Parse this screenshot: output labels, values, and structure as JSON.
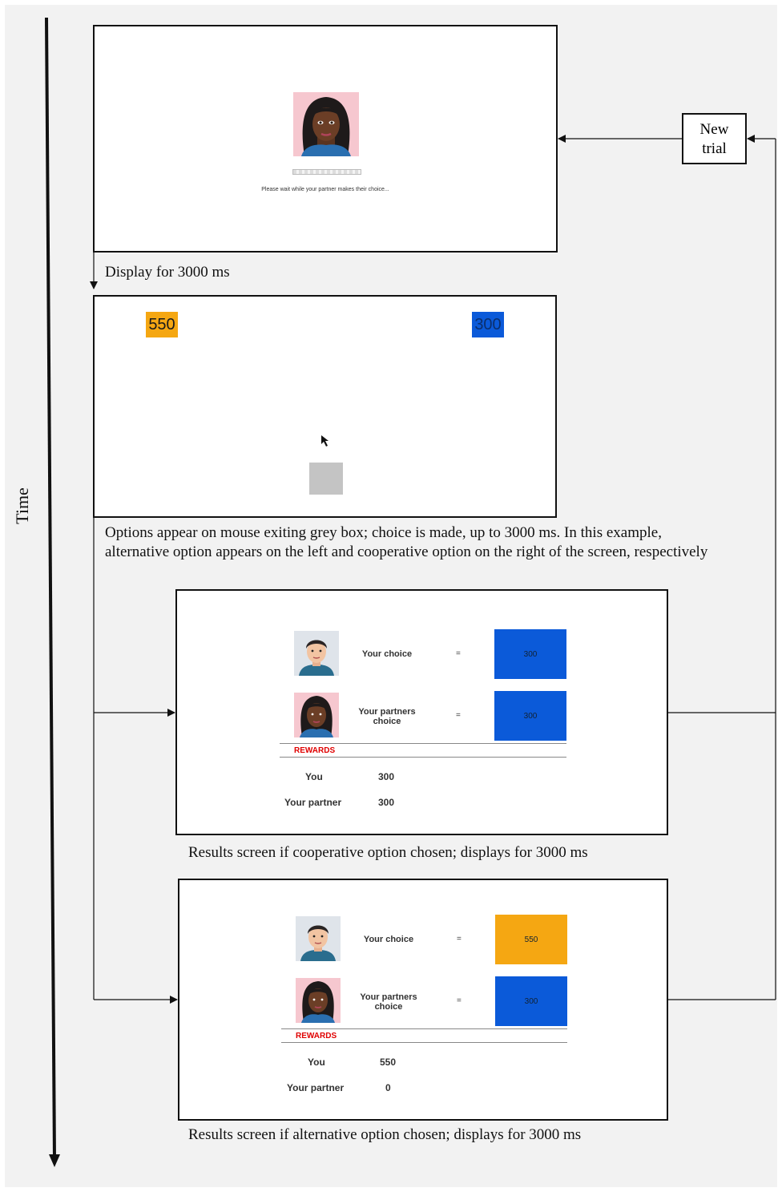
{
  "axis": {
    "time_label": "Time"
  },
  "new_trial": {
    "label_line1": "New",
    "label_line2": "trial"
  },
  "screen1": {
    "wait_text": "Please wait while your partner makes their choice...",
    "caption": "Display for 3000 ms"
  },
  "screen2": {
    "left_option": "550",
    "right_option": "300",
    "caption_line1": "Options appear on mouse exiting grey box; choice is made, up to 3000 ms. In this example,",
    "caption_line2": "alternative option appears on the left and cooperative option on the right of the screen, respectively"
  },
  "screen3": {
    "your_choice_label": "Your choice",
    "partner_choice_line1": "Your partners",
    "partner_choice_line2": "choice",
    "equals": "=",
    "your_choice_value": "300",
    "partner_choice_value": "300",
    "rewards_label": "REWARDS",
    "you_label": "You",
    "you_value": "300",
    "partner_label": "Your partner",
    "partner_value": "300",
    "caption": "Results screen  if cooperative option chosen; displays for 3000 ms"
  },
  "screen4": {
    "your_choice_label": "Your choice",
    "partner_choice_line1": "Your partners",
    "partner_choice_line2": "choice",
    "equals": "=",
    "your_choice_value": "550",
    "partner_choice_value": "300",
    "rewards_label": "REWARDS",
    "you_label": "You",
    "you_value": "550",
    "partner_label": "Your partner",
    "partner_value": "0",
    "caption": "Results screen  if alternative option chosen; displays for 3000 ms"
  },
  "colors": {
    "alternative_option": "#f5a712",
    "cooperative_option": "#0b5ad9",
    "grey_box": "#c4c4c4",
    "rewards_red": "#e00000"
  }
}
